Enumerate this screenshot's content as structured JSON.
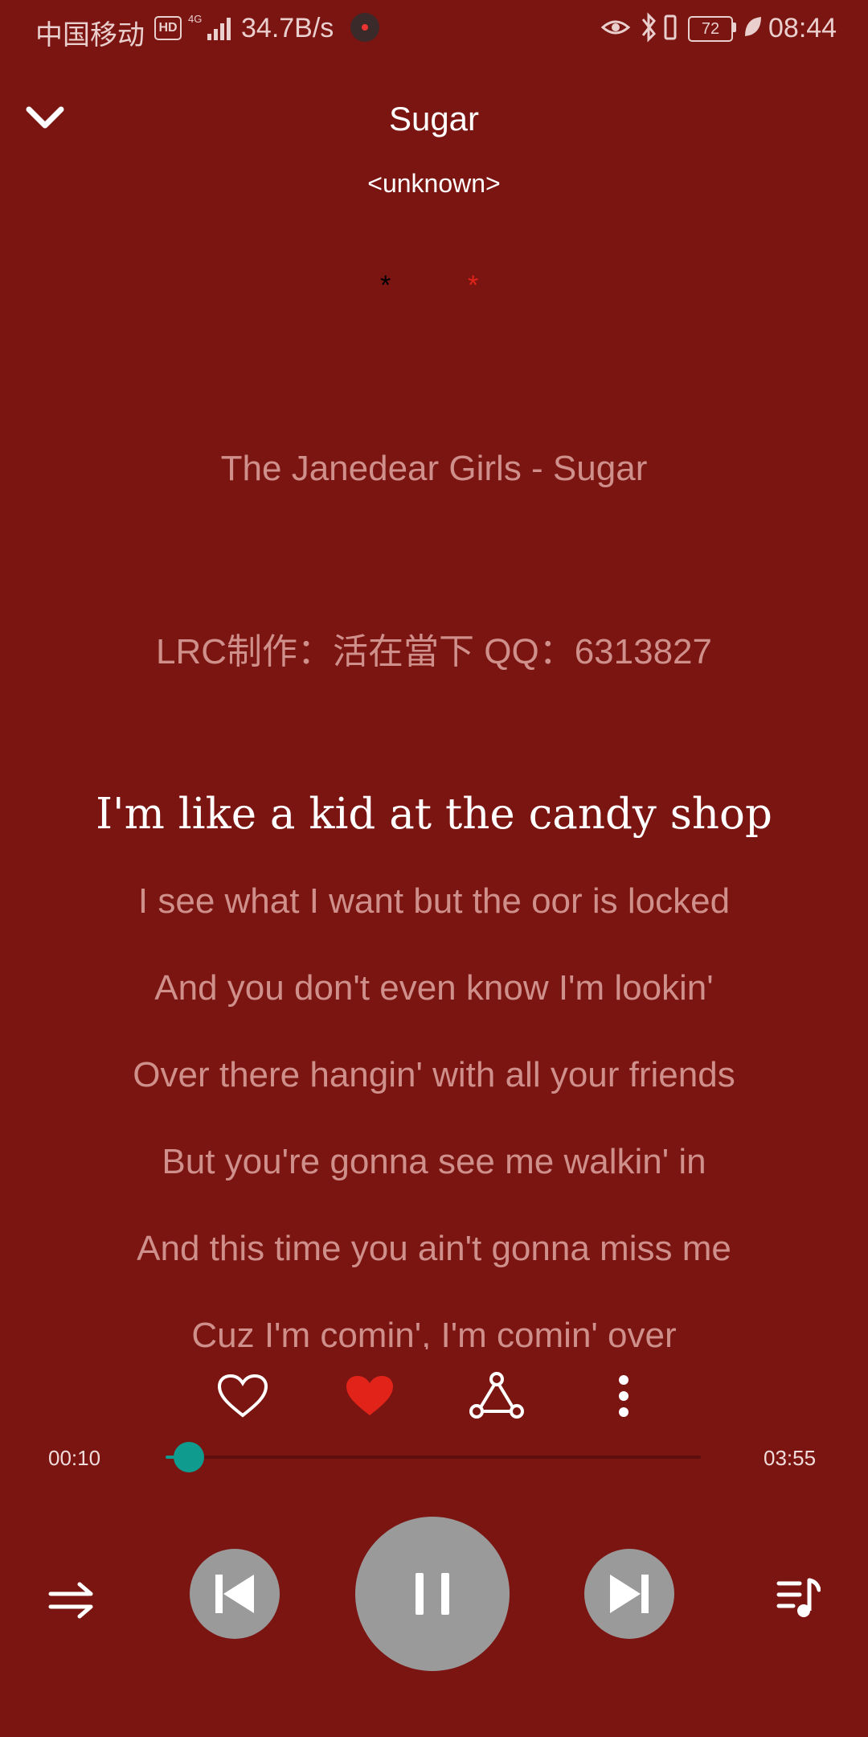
{
  "status_bar": {
    "carrier": "中国移动",
    "hd": "HD",
    "network": "4G",
    "speed": "34.7B/s",
    "battery": "72",
    "time": "08:44"
  },
  "header": {
    "title": "Sugar",
    "artist": "<unknown>"
  },
  "stars": [
    "*",
    "*"
  ],
  "lyrics": {
    "credit_line": "The Janedear Girls - Sugar",
    "lrc_line": "LRC制作：活在當下     QQ：6313827",
    "current": "I'm like a kid at the candy shop",
    "upcoming": [
      "I see what I want but the oor is locked",
      "And you don't even know I'm lookin'",
      "Over there hangin' with all your friends",
      "But you're gonna see me walkin' in",
      "And this time you ain't gonna miss me",
      "Cuz I'm comin', I'm comin' over"
    ]
  },
  "progress": {
    "current_time": "00:10",
    "total_time": "03:55",
    "fraction": 0.043
  },
  "colors": {
    "background": "#7b1512",
    "accent": "#0f9b8e",
    "favorite": "#e2231a",
    "control_bg": "#9a9a9a"
  },
  "icons": {
    "back": "chevron-down-icon",
    "like": "heart-outline-icon",
    "favorite": "heart-filled-icon",
    "share": "share-icon",
    "more": "more-vertical-icon",
    "shuffle": "shuffle-icon",
    "prev": "skip-previous-icon",
    "play_pause": "pause-icon",
    "next": "skip-next-icon",
    "playlist": "playlist-icon"
  }
}
